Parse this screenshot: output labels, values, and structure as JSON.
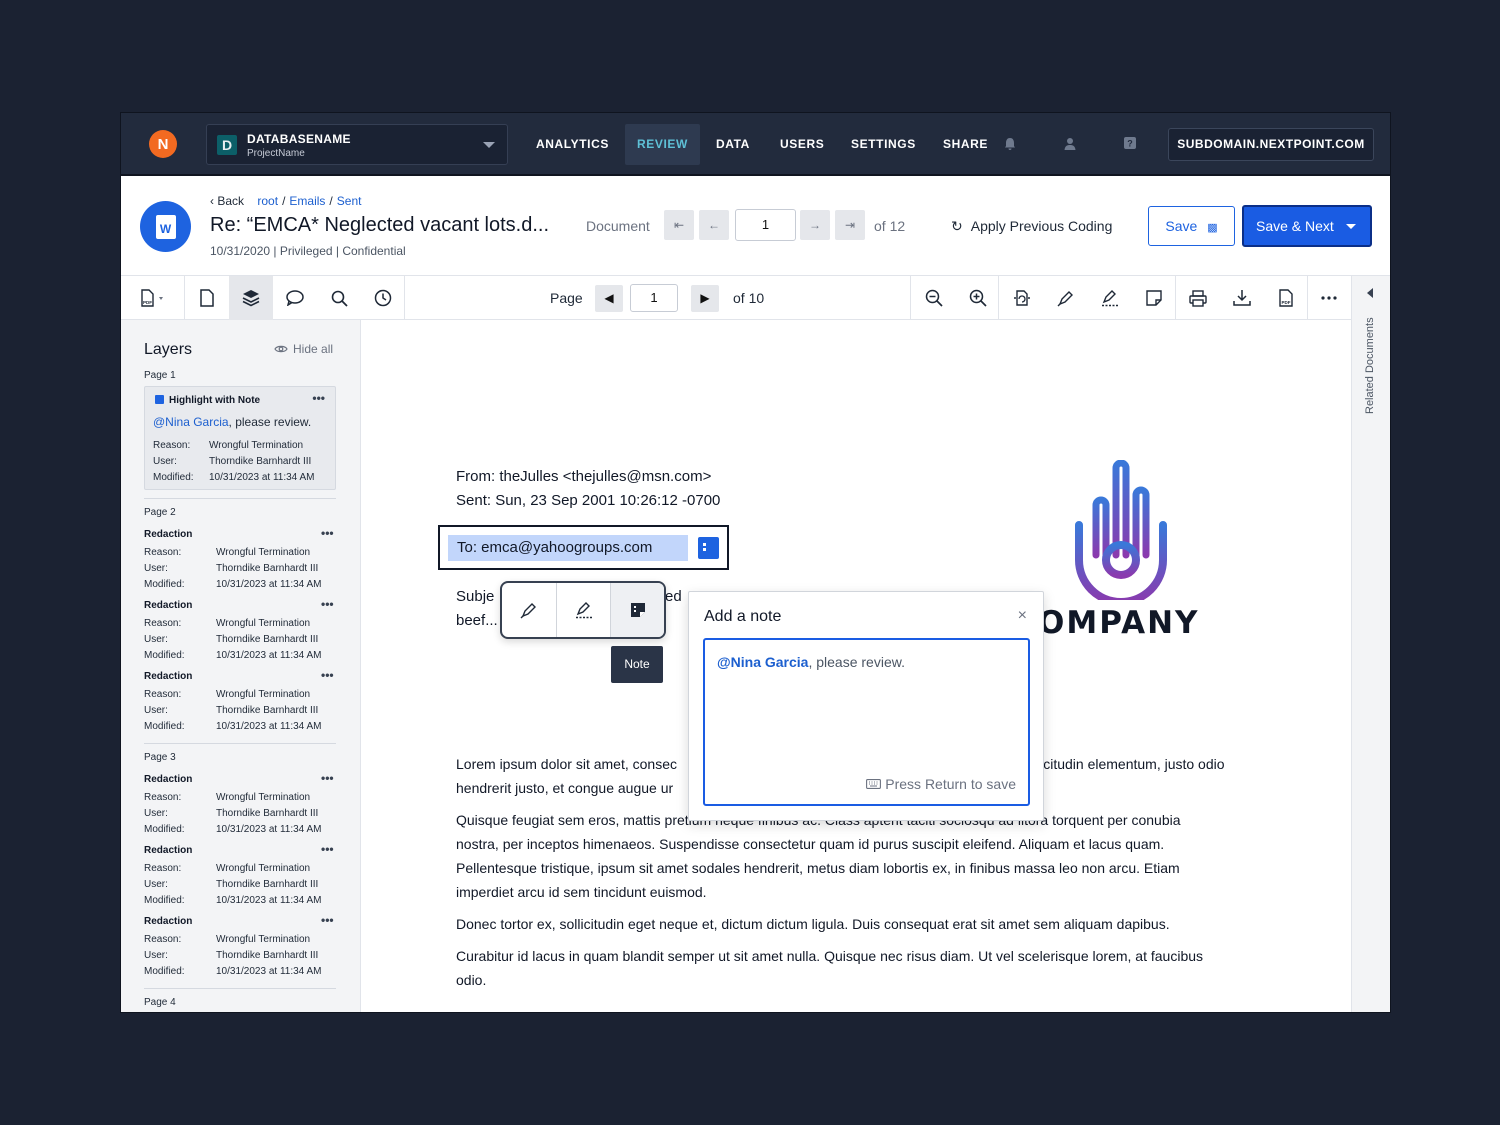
{
  "nav": {
    "logo_glyph": "N",
    "db_badge": "D",
    "db_name": "DATABASENAME",
    "project": "ProjectName",
    "items": [
      "ANALYTICS",
      "REVIEW",
      "DATA",
      "USERS",
      "SETTINGS",
      "SHARE"
    ],
    "active": "REVIEW",
    "subdomain": "SUBDOMAIN.NEXTPOINT.COM",
    "icons": [
      "bell-icon",
      "user-icon",
      "help-icon"
    ]
  },
  "doc": {
    "back": "Back",
    "crumbs": [
      "root",
      "Emails",
      "Sent"
    ],
    "title": "Re: “EMCA* Neglected vacant lots.d...",
    "meta": "10/31/2020 | Privileged | Confidential",
    "icon_letter": "W",
    "document_label": "Document",
    "doc_number": "1",
    "doc_total": "of 12",
    "apply_previous": "Apply Previous Coding",
    "save": "Save",
    "save_next": "Save & Next"
  },
  "toolbar": {
    "page_label": "Page",
    "page_number": "1",
    "page_total": "of 10"
  },
  "rail": {
    "label": "Related Documents"
  },
  "layers": {
    "title": "Layers",
    "hide_all": "Hide all",
    "page1": {
      "label": "Page 1",
      "card": {
        "title": "Highlight with Note",
        "mention": "@Nina Garcia",
        "message": ", please review.",
        "reason_k": "Reason:",
        "reason": "Wrongful Termination",
        "user_k": "User:",
        "user": "Thorndike Barnhardt III",
        "modified_k": "Modified:",
        "modified": "10/31/2023 at 11:34 AM"
      }
    },
    "page2_label": "Page 2",
    "page3_label": "Page 3",
    "page4_label": "Page 4",
    "redaction": {
      "title": "Redaction",
      "reason_k": "Reason:",
      "reason": "Wrongful Termination",
      "user_k": "User:",
      "user": "Thorndike Barnhardt III",
      "modified_k": "Modified:",
      "modified": "10/31/2023 at 11:34 AM"
    }
  },
  "viewer": {
    "from": "From: theJulles <thejulles@msn.com>",
    "sent": "Sent: Sun, 23 Sep 2001 10:26:12 -0700",
    "to": "To: emca@yahoogroups.com",
    "subject_start": "Subje",
    "subject_end": "ed",
    "beef": "beef...",
    "tooltip": "Note",
    "company": "OMPANY",
    "para1a": "Lorem ipsum dolor sit amet, consec",
    "para1b": "licitudin elementum, justo odio",
    "para1c": "hendrerit justo, et congue augue ur",
    "para2a": "Quisque feugiat sem eros, mattis pretium neque finibus ac. Class aptent taciti sociosqu ad litora torquent per conubia",
    "para2b": "nostra, per inceptos himenaeos. Suspendisse consectetur quam id purus suscipit eleifend. Aliquam et lacus quam.",
    "para2c": "Pellentesque tristique, ipsum sit amet sodales hendrerit, metus diam lobortis ex, in finibus massa leo non arcu. Etiam",
    "para2d": "imperdiet arcu id sem tincidunt euismod.",
    "para3": "Donec tortor ex, sollicitudin eget neque et, dictum dictum ligula. Duis consequat erat sit amet sem aliquam dapibus.",
    "para4a": "Curabitur id lacus in quam blandit semper ut sit amet nulla. Quisque nec risus diam. Ut vel scelerisque lorem, at faucibus",
    "para4b": "odio."
  },
  "note": {
    "title": "Add a note",
    "close": "×",
    "mention": "@Nina Garcia",
    "message": ", please review.",
    "hint": "Press Return to save"
  },
  "colors": {
    "accent": "#1a5ce3",
    "nav_bg": "#222b3d",
    "highlight": "#c2d6fb",
    "logo_orange": "#f26a21"
  }
}
